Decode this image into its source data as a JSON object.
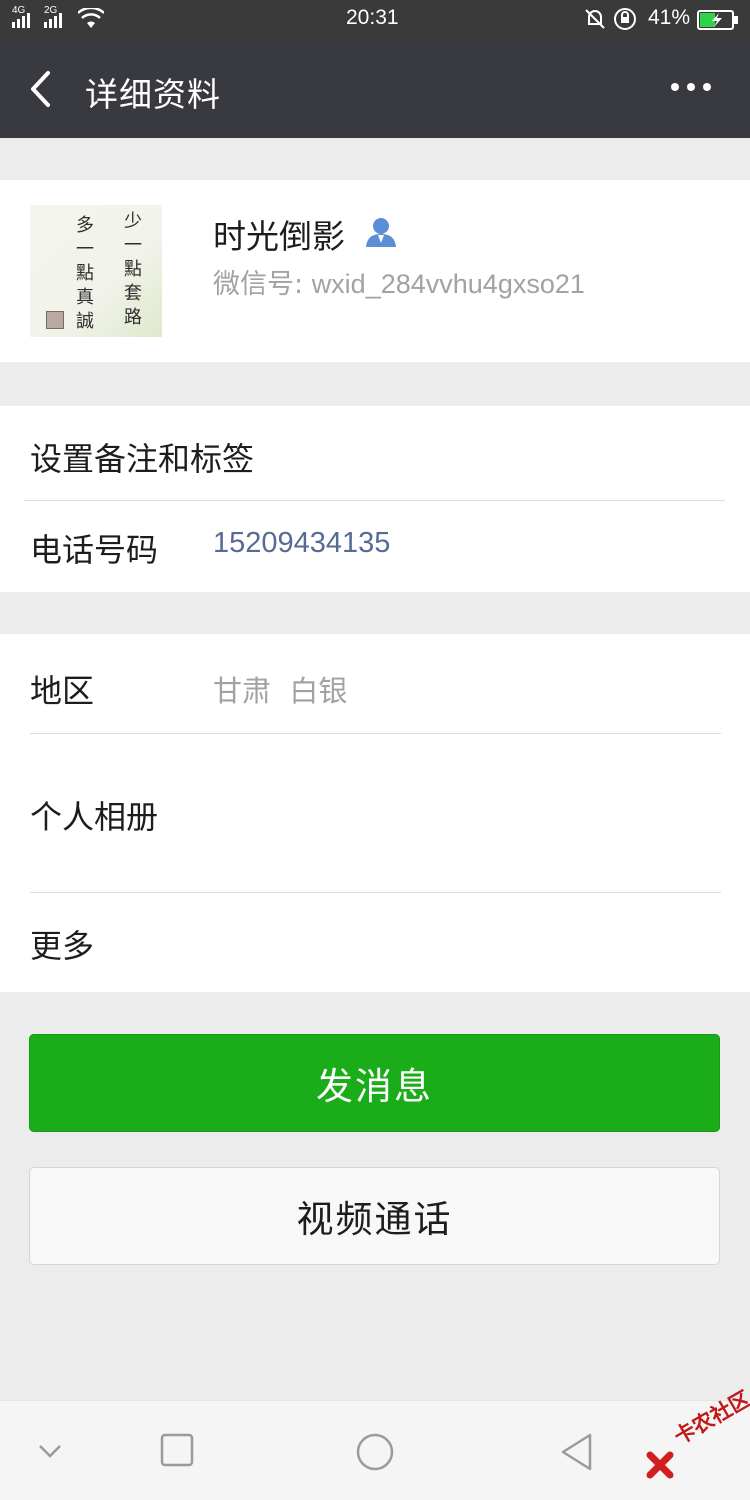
{
  "status_bar": {
    "network_left": "4G",
    "network_right": "2G",
    "time": "20:31",
    "battery_percent": "41%"
  },
  "header": {
    "title": "详细资料"
  },
  "profile": {
    "name": "时光倒影",
    "wxid_label": "微信号: ",
    "wxid": "wxid_284vvhu4gxso21",
    "avatar_text_col1": "少一點套路",
    "avatar_text_col2": "多一點真誠"
  },
  "section1": {
    "remark_label": "设置备注和标签",
    "phone_label": "电话号码",
    "phone_value": "15209434135"
  },
  "section2": {
    "region_label": "地区",
    "region_value": "甘肃  白银",
    "album_label": "个人相册",
    "more_label": "更多"
  },
  "actions": {
    "send_message": "发消息",
    "video_call": "视频通话"
  },
  "watermark": {
    "text": "卡农社区"
  },
  "colors": {
    "accent_green": "#1aad19",
    "link_blue": "#576b95",
    "header_bg": "#393a3f"
  }
}
